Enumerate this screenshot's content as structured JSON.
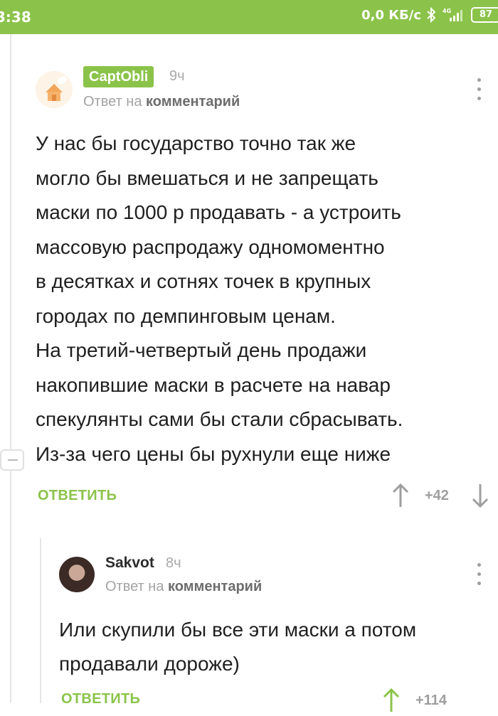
{
  "status_bar": {
    "time": "3:38",
    "network_speed": "0,0 КБ/с",
    "signal_label": "4G",
    "battery": "87",
    "icons": [
      "bluetooth-icon",
      "signal-icon",
      "battery-icon"
    ]
  },
  "comment1": {
    "author": "CaptObli",
    "time": "9ч",
    "reply_prefix": "Ответ на",
    "reply_target": "комментарий",
    "text": "У нас бы государство точно так же\nмогло бы вмешаться и не запрещать\nмаски по 1000 р продавать - а устроить\nмассовую распродажу одномоментно\nв десятках и сотнях точек в крупных\nгородах по демпинговым ценам.\nНа третий-четвертый день продажи\nнакопившие маски в расчете на навар\nспекулянты сами бы стали сбрасывать.\nИз-за чего цены бы рухнули еще ниже",
    "reply_label": "ОТВЕТИТЬ",
    "score": "+42"
  },
  "comment2": {
    "author": "Sakvot",
    "time": "8ч",
    "reply_prefix": "Ответ на",
    "reply_target": "комментарий",
    "text": "Или скупили бы все эти маски а потом\nпродавали дороже)",
    "reply_label": "ОТВЕТИТЬ",
    "score": "+114"
  },
  "colors": {
    "accent": "#8bc34a",
    "muted": "#9e9e9e"
  }
}
